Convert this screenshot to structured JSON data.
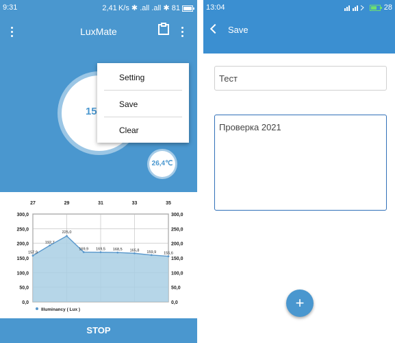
{
  "left": {
    "status": {
      "time": "9:31",
      "right": "2,41 K/s ✱ .all .all ✱ 81"
    },
    "app_title": "LuxMate",
    "gauge_value": "155",
    "temperature": "26,4℃",
    "menu": {
      "setting": "Setting",
      "save": "Save",
      "clear": "Clear"
    },
    "stop_label": "STOP"
  },
  "right": {
    "status": {
      "time": "13:04",
      "right": "28"
    },
    "header_title": "Save",
    "title_field_value": "Тест",
    "note_field_value": "Проверка 2021",
    "fab_label": "+"
  },
  "chart_data": {
    "type": "area",
    "x_ticks": [
      "27",
      "29",
      "31",
      "33",
      "35"
    ],
    "y_ticks": [
      "300,0",
      "250,0",
      "200,0",
      "150,0",
      "100,0",
      "50,0",
      "0,0"
    ],
    "ylim": [
      0,
      300
    ],
    "xlim": [
      27,
      35
    ],
    "series": [
      {
        "name": "Illuminancy ( Lux )",
        "x": [
          27,
          28,
          29,
          30,
          31,
          32,
          33,
          34,
          35
        ],
        "values": [
          157.9,
          192.7,
          225.0,
          169.9,
          169.5,
          168.5,
          165.8,
          159.9,
          155.6
        ],
        "labels": [
          "157,9",
          "192,7",
          "225,0",
          "169,9",
          "169,5",
          "168,5",
          "165,8",
          "159,9",
          "155,6"
        ]
      }
    ],
    "colors": {
      "line": "#5a98cc",
      "fill": "#a9cfe4"
    },
    "legend": "bottom-left",
    "grid": true
  }
}
